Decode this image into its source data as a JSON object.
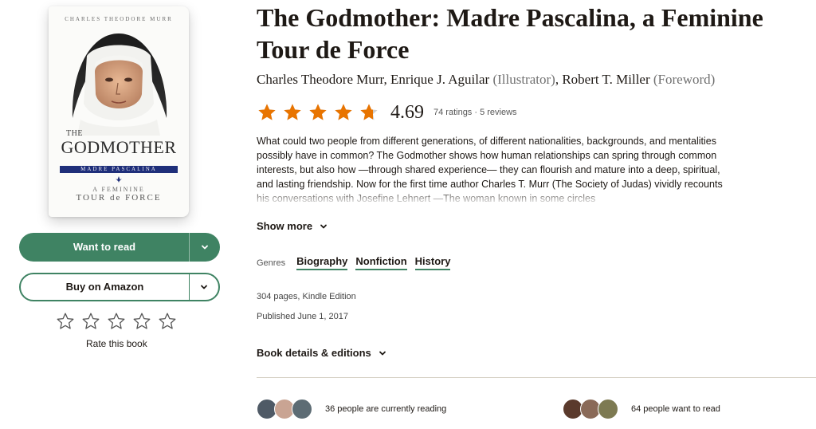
{
  "book": {
    "title": "The Godmother: Madre Pascalina, a Feminine Tour de Force",
    "contributors": [
      {
        "name": "Charles Theodore Murr",
        "role": ""
      },
      {
        "name": "Enrique J. Aguilar",
        "role": "(Illustrator)"
      },
      {
        "name": "Robert T. Miller",
        "role": "(Foreword)"
      }
    ],
    "rating": {
      "average": "4.69",
      "stars_value": 4.69,
      "stars_max": 5,
      "counts": "74 ratings · 5 reviews"
    },
    "description": "What could two people from different generations, of different nationalities, backgrounds, and mentalities possibly have in common? The Godmother shows how human relationships can spring through common interests, but also how —through shared experience— they can flourish and mature into a deep, spiritual, and lasting friendship. Now for the first time author Charles T. Murr (The Society of Judas) vividly recounts his conversations with Josefine Lehnert —The woman known in some circles",
    "show_more": "Show more",
    "genres_label": "Genres",
    "genres": [
      "Biography",
      "Nonfiction",
      "History"
    ],
    "pages_format": "304 pages, Kindle Edition",
    "published": "Published June 1, 2017",
    "details_label": "Book details & editions"
  },
  "cover": {
    "author": "CHARLES THEODORE MURR",
    "title_small": "THE",
    "title": "GODMOTHER",
    "band": "MADRE PASCALINA",
    "sub1": "A FEMININE",
    "sub2": "TOUR de FORCE"
  },
  "actions": {
    "want_to_read": "Want to read",
    "buy": "Buy on Amazon",
    "rate_label": "Rate this book",
    "rate_stars": 5
  },
  "social": {
    "currently_reading": "36 people are currently reading",
    "want_to_read": "64 people want to read"
  },
  "colors": {
    "accent": "#3f8363",
    "star": "#e87400",
    "star_empty": "#cfcfcf"
  },
  "icons": {
    "chevron": "chevron-down-icon",
    "star": "star-icon"
  }
}
